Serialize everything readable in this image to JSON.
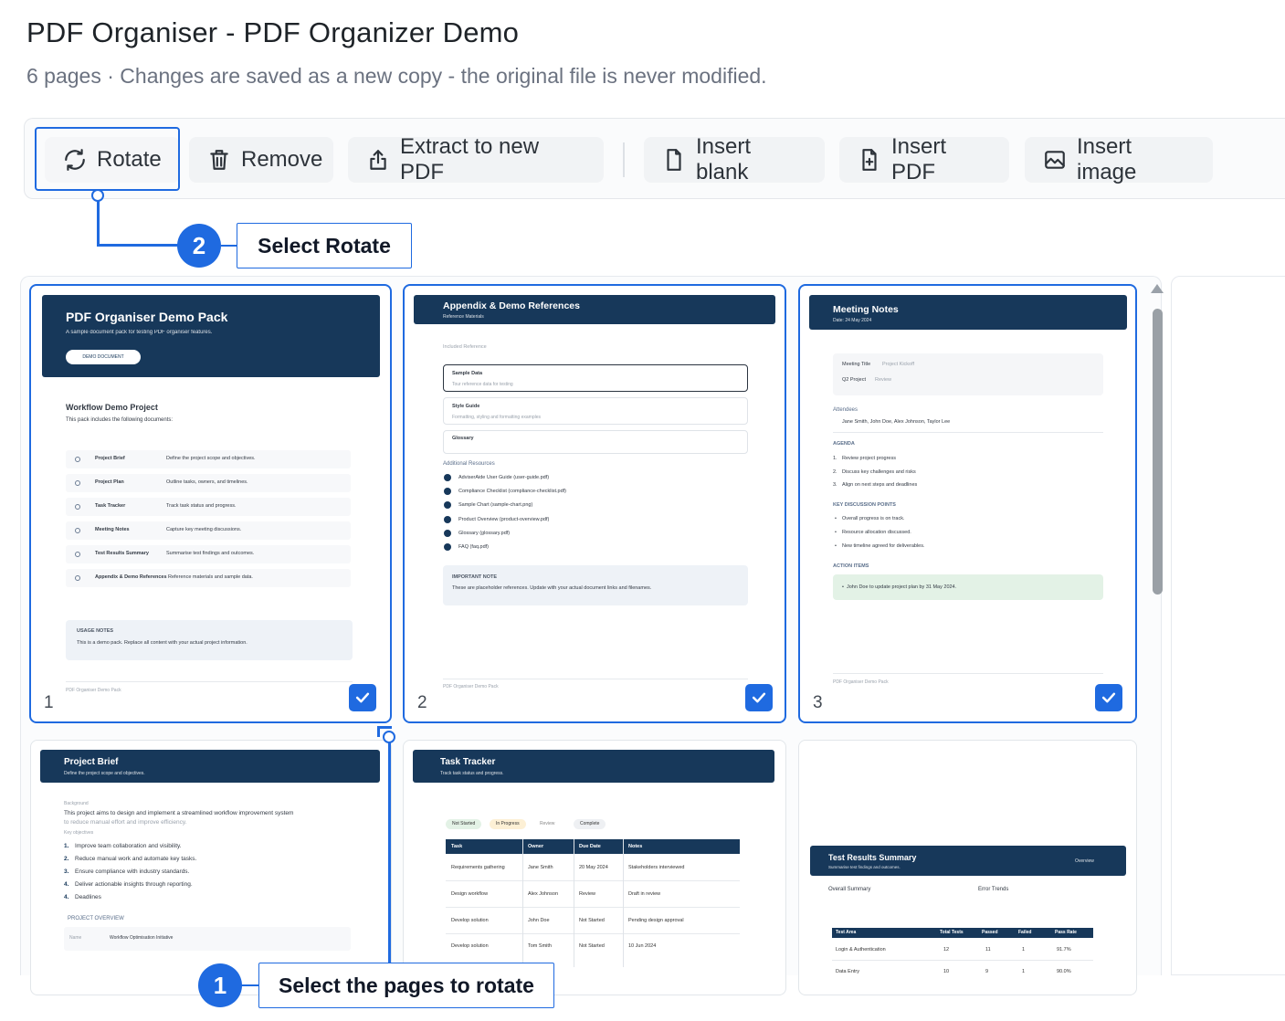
{
  "page": {
    "title": "PDF Organiser - PDF Organizer Demo",
    "subtitle": "6 pages · Changes are saved as a new copy - the original file is never modified."
  },
  "toolbar": {
    "rotate": "Rotate",
    "remove": "Remove",
    "extract": "Extract to new PDF",
    "insert_blank": "Insert blank",
    "insert_pdf": "Insert PDF",
    "insert_image": "Insert image"
  },
  "callouts": {
    "step2_number": "2",
    "step2_label": "Select Rotate",
    "step1_number": "1",
    "step1_label": "Select the pages to rotate"
  },
  "accent_color": "#1f6ae0",
  "brand_dark": "#17385a",
  "pages": [
    {
      "number": "1",
      "selected": true,
      "header_title": "PDF Organiser Demo Pack",
      "header_sub": "A sample document pack for testing PDF organiser features.",
      "badge": "DEMO DOCUMENT",
      "section_title": "Workflow Demo Project",
      "section_sub": "This pack includes the following documents:",
      "items": [
        {
          "name": "Project Brief",
          "desc": "Define the project scope and objectives."
        },
        {
          "name": "Project Plan",
          "desc": "Outline tasks, owners, and timelines."
        },
        {
          "name": "Task Tracker",
          "desc": "Track task status and progress."
        },
        {
          "name": "Meeting Notes",
          "desc": "Capture key meeting discussions."
        },
        {
          "name": "Test Results Summary",
          "desc": "Summarise test findings and outcomes."
        },
        {
          "name": "Appendix & Demo References",
          "desc": "Reference materials and sample data."
        }
      ],
      "notes_title": "USAGE NOTES",
      "notes_text": "This is a demo pack. Replace all content with your actual project information.",
      "footer": "PDF Organiser Demo Pack"
    },
    {
      "number": "2",
      "selected": true,
      "header_title": "Appendix & Demo References",
      "header_sub": "Reference Materials",
      "intro": "Included Reference",
      "fields": [
        "Sample Data",
        "Style Guide",
        "Glossary"
      ],
      "field_desc": [
        "Tour reference data for testing",
        "Formatting, styling and formatting examples"
      ],
      "resources_title": "Additional Resources",
      "resources": [
        "AdviserAide User Guide (user-guide.pdf)",
        "Compliance Checklist (compliance-checklist.pdf)",
        "Sample Chart (sample-chart.png)",
        "Product Overview (product-overview.pdf)",
        "Glossary (glossary.pdf)",
        "FAQ (faq.pdf)"
      ],
      "note_title": "IMPORTANT NOTE",
      "note_text": "These are placeholder references. Update with your actual document links and filenames.",
      "footer": "PDF Organiser Demo Pack"
    },
    {
      "number": "3",
      "selected": true,
      "header_title": "Meeting Notes",
      "header_sub": "Date: 24 May 2024",
      "meeting_title_label": "Meeting Title",
      "meeting_title_value": "Project Kickoff",
      "project_label": "Q2 Project",
      "project_value": "Review",
      "attendees_label": "Attendees",
      "attendees": "Jane Smith, John Doe, Alex Johnson, Taylor Lee",
      "agenda_label": "AGENDA",
      "agenda": [
        "Review project progress",
        "Discuss key challenges and risks",
        "Align on next steps and deadlines"
      ],
      "kdp_label": "KEY DISCUSSION POINTS",
      "kdp": [
        "Overall progress is on track.",
        "Resource allocation discussed.",
        "New timeline agreed for deliverables."
      ],
      "actions_label": "ACTION ITEMS",
      "action": "John Doe to update project plan by 31 May 2024.",
      "footer": "PDF Organiser Demo Pack"
    },
    {
      "number": "4",
      "selected": false,
      "header_title": "Project Brief",
      "header_sub": "Define the project scope and objectives.",
      "intro_label": "Background",
      "intro": "This project aims to design and implement a streamlined workflow improvement system",
      "intro2": "to reduce manual effort and improve efficiency.",
      "obj_label": "Key objectives",
      "objectives": [
        "Improve team collaboration and visibility.",
        "Reduce manual work and automate key tasks.",
        "Ensure compliance with industry standards.",
        "Deliver actionable insights through reporting.",
        "Deadlines"
      ],
      "overview_label": "PROJECT OVERVIEW",
      "name_label": "Name",
      "name_value": "Workflow Optimisation Initiative"
    },
    {
      "number": "5",
      "selected": false,
      "header_title": "Task Tracker",
      "header_sub": "Track task status and progress.",
      "statuses": [
        "Not Started",
        "In Progress",
        "Review",
        "Complete"
      ],
      "columns": [
        "Task",
        "Owner",
        "Due Date",
        "Notes"
      ],
      "rows": [
        [
          "Requirements gathering",
          "Jane Smith",
          "20 May 2024",
          "Stakeholders interviewed"
        ],
        [
          "Design workflow",
          "Alex Johnson",
          "Review",
          "Draft in review"
        ],
        [
          "Develop solution",
          "John Doe",
          "Not Started",
          "Pending design approval"
        ],
        [
          "Develop solution",
          "Tom Smith",
          "Not Started",
          "10 Jun 2024"
        ]
      ]
    },
    {
      "number": "6",
      "selected": false,
      "header_title": "Test Results Summary",
      "header_sub": "Summarise test findings and outcomes.",
      "badge": "Overview",
      "overall_label": "Overall Summary",
      "errors_label": "Error Trends",
      "columns": [
        "Test Area",
        "Total Tests",
        "Passed",
        "Failed",
        "Pass Rate"
      ],
      "rows": [
        [
          "Login & Authentication",
          "12",
          "11",
          "1",
          "91.7%"
        ],
        [
          "Data Entry",
          "10",
          "9",
          "1",
          "90.0%"
        ]
      ]
    }
  ]
}
